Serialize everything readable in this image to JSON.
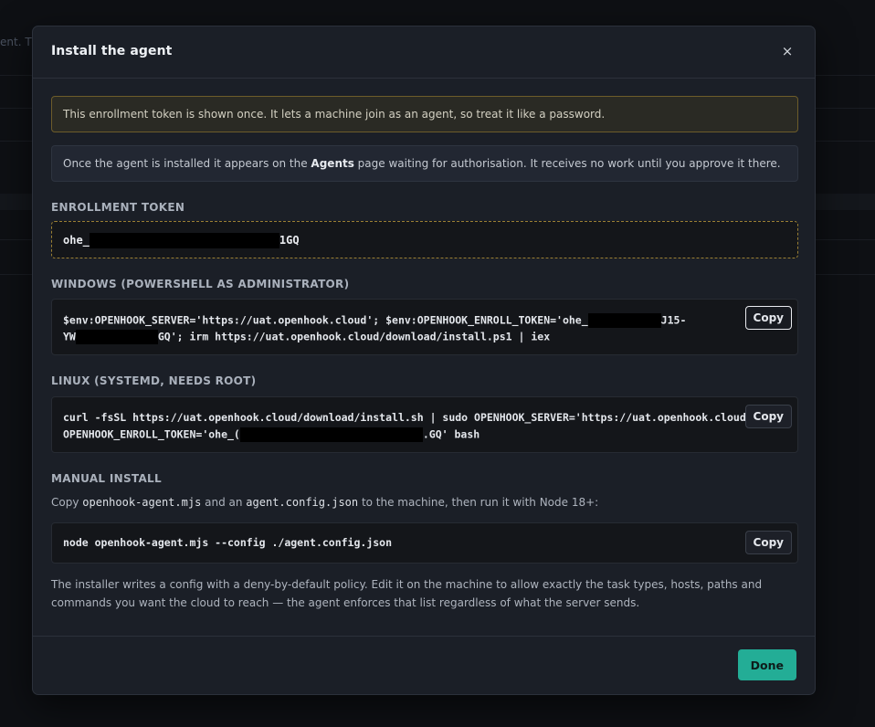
{
  "background": {
    "peek_text": "ent. Th"
  },
  "modal": {
    "title": "Install the agent",
    "close_glyph": "×",
    "warning": "This enrollment token is shown once. It lets a machine join as an agent, so treat it like a password.",
    "info": {
      "before": "Once the agent is installed it appears on the ",
      "bold": "Agents",
      "after": " page waiting for authorisation. It receives no work until you approve it there."
    },
    "token": {
      "label": "ENROLLMENT TOKEN",
      "prefix": "ohe_",
      "suffix": "1GQ"
    },
    "windows": {
      "label": "WINDOWS (POWERSHELL AS ADMINISTRATOR)",
      "line1_a": "$env:OPENHOOK_SERVER='https://uat.openhook.cloud'; $env:OPENHOOK_ENROLL_TOKEN='ohe_",
      "line1_b": "J15-",
      "line2_a": "YW",
      "line2_b": "GQ'; irm https://uat.openhook.cloud/download/install.ps1 | iex",
      "copy_label": "Copy"
    },
    "linux": {
      "label": "LINUX (SYSTEMD, NEEDS ROOT)",
      "line1": "curl -fsSL https://uat.openhook.cloud/download/install.sh | sudo OPENHOOK_SERVER='https://uat.openhook.cloud'",
      "line2_a": "OPENHOOK_ENROLL_TOKEN='ohe_(",
      "line2_b": ".GQ' bash",
      "copy_label": "Copy"
    },
    "manual": {
      "label": "MANUAL INSTALL",
      "text_a": "Copy ",
      "code_a": "openhook-agent.mjs",
      "text_b": " and an ",
      "code_b": "agent.config.json",
      "text_c": " to the machine, then run it with Node 18+:",
      "command": "node openhook-agent.mjs --config ./agent.config.json",
      "copy_label": "Copy"
    },
    "policy_note": "The installer writes a config with a deny-by-default policy. Edit it on the machine to allow exactly the task types, hosts, paths and commands you want the cloud to reach — the agent enforces that list regardless of what the server sends.",
    "done_label": "Done"
  }
}
